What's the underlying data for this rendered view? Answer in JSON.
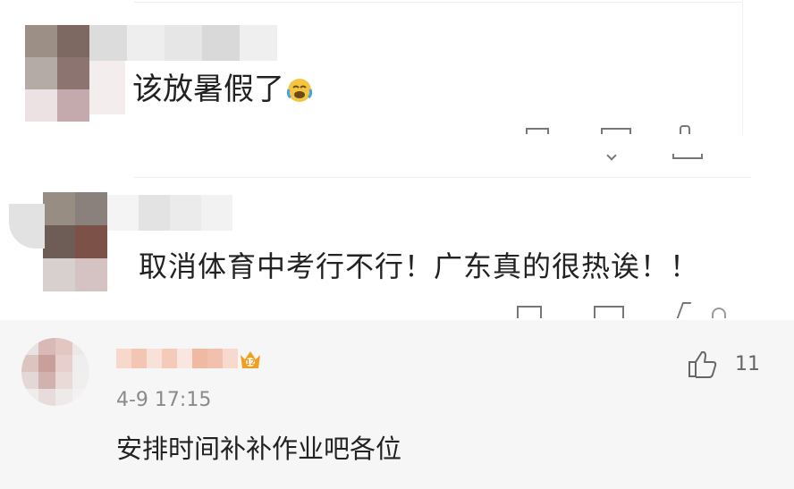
{
  "comments": [
    {
      "avatar": "blurred-avatar",
      "username": "",
      "content": "该放暑假了",
      "emoji": "crying-laughing-emoji",
      "timestamp": "",
      "like_count": ""
    },
    {
      "avatar": "blurred-avatar",
      "username": "",
      "content": "取消体育中考行不行！广东真的很热诶！！",
      "timestamp": "",
      "like_count": ""
    },
    {
      "avatar": "blurred-avatar",
      "username": "",
      "badge": "vip-badge",
      "timestamp": "4-9 17:15",
      "content": "安排时间补补作业吧各位",
      "like_count": "11",
      "like_icon": "thumbs-up-icon"
    }
  ],
  "colors": {
    "text": "#222222",
    "muted": "#8a8a8a",
    "bottom_panel": "#f6f6f6",
    "divider": "#eeeeee",
    "badge": "#f0a020"
  }
}
